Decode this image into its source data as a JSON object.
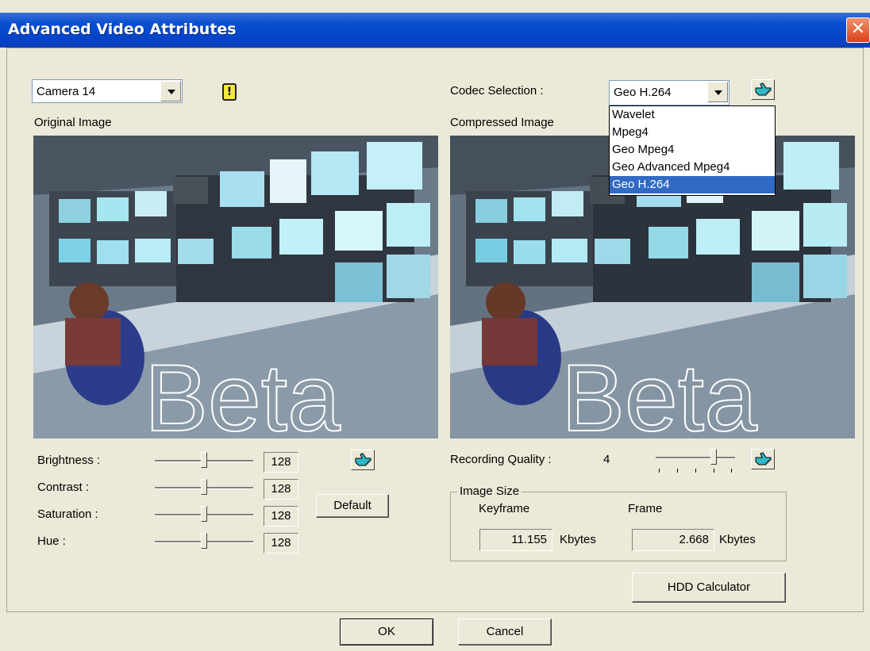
{
  "window": {
    "title": "Advanced Video Attributes",
    "close_glyph": "✕"
  },
  "camera": {
    "selected": "Camera 14",
    "warning_glyph": "!"
  },
  "codec": {
    "label": "Codec Selection :",
    "selected": "Geo H.264",
    "options": [
      "Wavelet",
      "Mpeg4",
      "Geo Mpeg4",
      "Geo Advanced Mpeg4",
      "Geo H.264"
    ],
    "selected_index": 4
  },
  "original_image": {
    "label": "Original Image",
    "watermark": "Beta"
  },
  "compressed_image": {
    "label": "Compressed Image",
    "watermark": "Beta"
  },
  "adjustments": [
    {
      "label": "Brightness :",
      "value": "128",
      "level": 0.5
    },
    {
      "label": "Contrast :",
      "value": "128",
      "level": 0.5
    },
    {
      "label": "Saturation :",
      "value": "128",
      "level": 0.5
    },
    {
      "label": "Hue :",
      "value": "128",
      "level": 0.5
    }
  ],
  "default_button": "Default",
  "recording_quality": {
    "label": "Recording Quality :",
    "value": "4",
    "level": 0.75
  },
  "image_size": {
    "title": "Image Size",
    "keyframe_label": "Keyframe",
    "frame_label": "Frame",
    "keyframe_value": "11.155",
    "frame_value": "2.668",
    "unit": "Kbytes"
  },
  "hdd_calculator_button": "HDD Calculator",
  "ok_button": "OK",
  "cancel_button": "Cancel",
  "colors": {
    "titlebar": "#0a4fd0",
    "dialog_bg": "#ece9d8",
    "selection": "#316ac5"
  }
}
